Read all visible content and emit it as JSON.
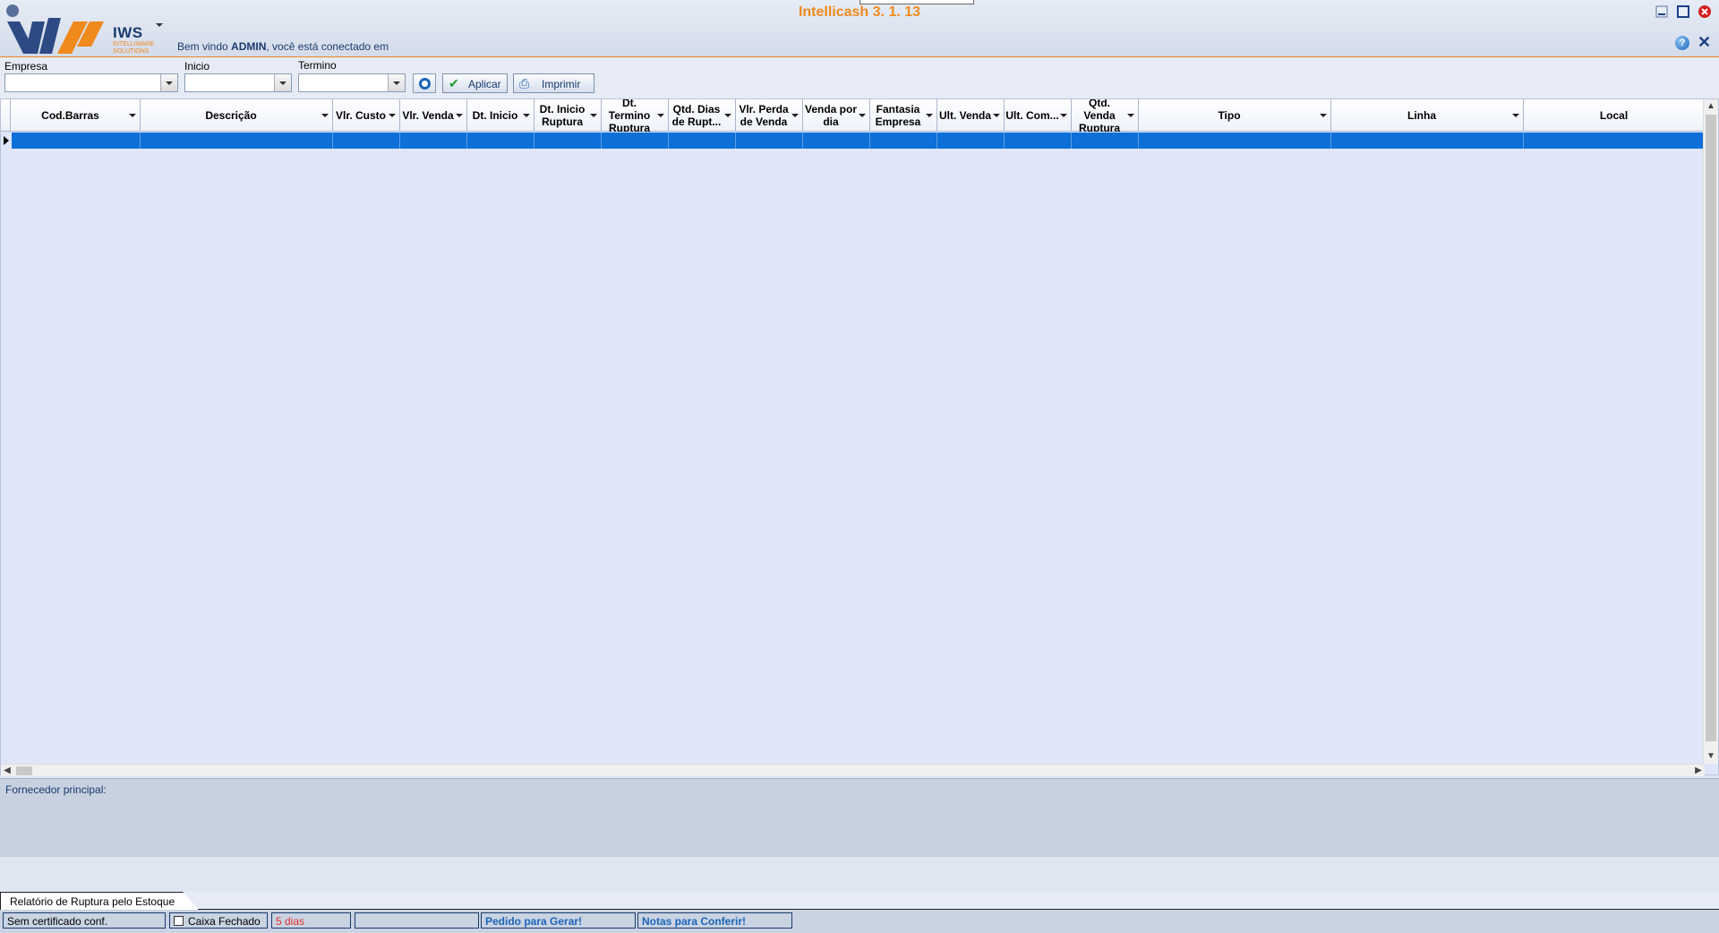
{
  "app": {
    "title": "Intellicash 3. 1. 13",
    "logo_text": "IWS",
    "logo_sub": "INTELLIWARE SOLUTIONS",
    "welcome_prefix": "Bem vindo ",
    "welcome_user": "ADMIN",
    "welcome_suffix": ", você está conectado em"
  },
  "filters": {
    "empresa_label": "Empresa",
    "empresa_value": "",
    "inicio_label": "Inicio",
    "inicio_value": "",
    "termino_label": "Termino",
    "termino_value": "",
    "apply_label": "Aplicar",
    "print_label": "Imprimir"
  },
  "grid": {
    "columns": [
      {
        "label": "Cod.Barras"
      },
      {
        "label": "Descrição"
      },
      {
        "label": "Vlr. Custo"
      },
      {
        "label": "Vlr. Venda"
      },
      {
        "label": "Dt. Inicio"
      },
      {
        "label": "Dt. Inicio Ruptura"
      },
      {
        "label": "Dt. Termino Ruptura"
      },
      {
        "label": "Qtd. Dias de Rupt..."
      },
      {
        "label": "Vlr. Perda de Venda"
      },
      {
        "label": "Venda por dia"
      },
      {
        "label": "Fantasia Empresa"
      },
      {
        "label": "Ult. Venda"
      },
      {
        "label": "Ult. Com..."
      },
      {
        "label": "Qtd. Venda Ruptura"
      },
      {
        "label": "Tipo"
      },
      {
        "label": "Linha"
      },
      {
        "label": "Local"
      }
    ]
  },
  "info_panel": {
    "fornecedor_label": "Fornecedor principal:"
  },
  "tabs": {
    "active_label": "Relatório de Ruptura pelo Estoque"
  },
  "statusbar": {
    "cert": "Sem certificado conf.",
    "caixa": "Caixa Fechado",
    "dias": "5 dias",
    "empty": "",
    "pedido": "Pedido para Gerar!",
    "notas": "Notas para Conferir!"
  },
  "colors": {
    "accent": "#f08a1d",
    "selection": "#0d6fd8",
    "brand_blue": "#1a3a6e"
  }
}
